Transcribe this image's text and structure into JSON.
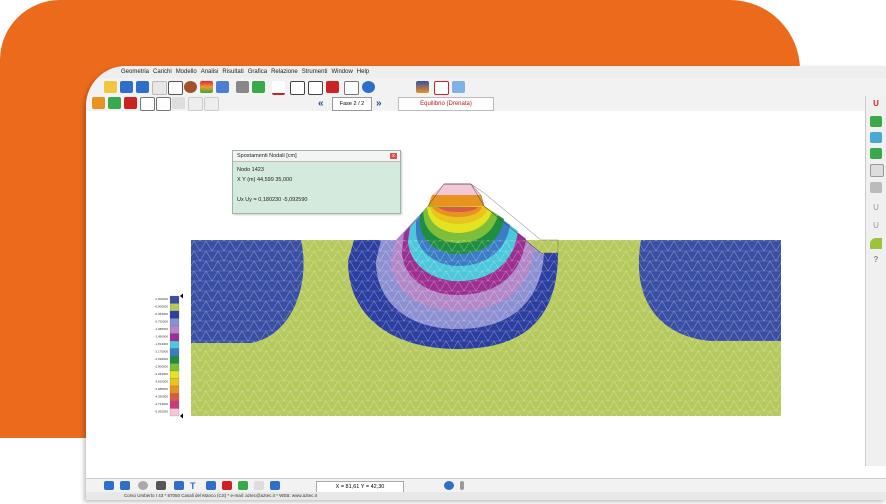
{
  "menu": [
    "Geometria",
    "Carichi",
    "Modello",
    "Analisi",
    "Risultati",
    "Grafica",
    "Relazione",
    "Strumenti",
    "Window",
    "Help"
  ],
  "toolbar": {
    "phase_label": "Fase 2 / 2",
    "tab_label": "Equilibrio (Drenata)"
  },
  "popup": {
    "title": "Spostamenti Nodali [cm]",
    "close_label": "x",
    "node": "Nodo 1423",
    "coords": "X   Y (m) 44,599   35,000",
    "disp": "Ux Uy = 0,180230  -5,092590"
  },
  "legend": {
    "labels": [
      "0,000000",
      "-0,000000",
      "-0,363000",
      "-0,725000",
      "-1,088000",
      "-1,450000",
      "-1,813000",
      "-2,175000",
      "-2,538000",
      "-2,900000",
      "-3,263000",
      "-3,625000",
      "-3,988000",
      "-4,350000",
      "-4,713000",
      "-5,092590"
    ],
    "colors": [
      "#3a4fa3",
      "#b6c95c",
      "#2c3fa0",
      "#8d8fd2",
      "#b287c7",
      "#9c2f91",
      "#4cc7dc",
      "#3b7dc4",
      "#1f8f3e",
      "#7dbf3b",
      "#e3e321",
      "#e8c41c",
      "#e8921f",
      "#d85a4a",
      "#c83b80",
      "#f4c7d9"
    ]
  },
  "bottom": {
    "coord": "X = 81,61  Y = 42,30"
  },
  "status": "Corso Umberto I 43 * 87050 Casali del Manco (CS) * e-mail: aztec@aztec.it * WEB: www.aztec.it",
  "right_panel_glyphs": [
    "U",
    "?"
  ],
  "colors": {
    "accent_orange": "#ec6a1c",
    "soil_green": "#b6c95c",
    "mesh_blue": "#3a4fa3",
    "close_red": "#d9534f"
  }
}
